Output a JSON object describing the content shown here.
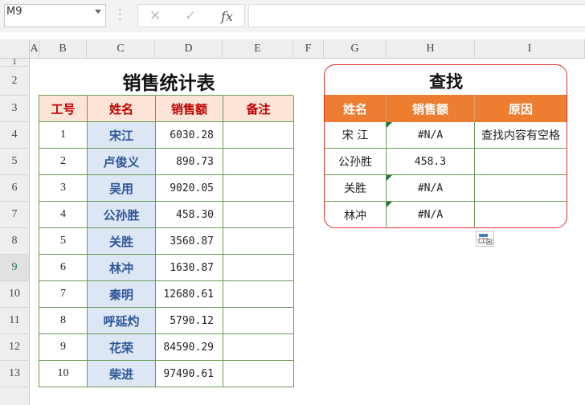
{
  "formula_bar": {
    "name_box": "M9",
    "cancel_icon": "✕",
    "enter_icon": "✓",
    "fx_label": "fx",
    "formula": ""
  },
  "columns": [
    "A",
    "B",
    "C",
    "D",
    "E",
    "F",
    "G",
    "H",
    "I"
  ],
  "rows": [
    "1",
    "2",
    "3",
    "4",
    "5",
    "6",
    "7",
    "8",
    "9",
    "10",
    "11",
    "12",
    "13"
  ],
  "active_row": "9",
  "sales_table": {
    "title": "销售统计表",
    "headers": [
      "工号",
      "姓名",
      "销售额",
      "备注"
    ],
    "rows": [
      {
        "id": "1",
        "name": "宋江",
        "amount": "6030.28",
        "note": ""
      },
      {
        "id": "2",
        "name": "卢俊义",
        "amount": "890.73",
        "note": ""
      },
      {
        "id": "3",
        "name": "吴用",
        "amount": "9020.05",
        "note": ""
      },
      {
        "id": "4",
        "name": "公孙胜",
        "amount": "458.30",
        "note": ""
      },
      {
        "id": "5",
        "name": "关胜",
        "amount": "3560.87",
        "note": ""
      },
      {
        "id": "6",
        "name": "林冲",
        "amount": "1630.87",
        "note": ""
      },
      {
        "id": "7",
        "name": "秦明",
        "amount": "12680.61",
        "note": ""
      },
      {
        "id": "8",
        "name": "呼延灼",
        "amount": "5790.12",
        "note": ""
      },
      {
        "id": "9",
        "name": "花荣",
        "amount": "84590.29",
        "note": ""
      },
      {
        "id": "10",
        "name": "柴进",
        "amount": "97490.61",
        "note": ""
      }
    ]
  },
  "lookup_table": {
    "title": "查找",
    "headers": [
      "姓名",
      "销售额",
      "原因"
    ],
    "rows": [
      {
        "name": "宋 江",
        "amount": "#N/A",
        "reason": "查找内容有空格",
        "flag": true
      },
      {
        "name": "公孙胜",
        "amount": "458.3",
        "reason": "",
        "flag": false
      },
      {
        "name": "关胜",
        "amount": "#N/A",
        "reason": "",
        "flag": true
      },
      {
        "name": "林冲",
        "amount": "#N/A",
        "reason": "",
        "flag": true
      }
    ]
  },
  "colors": {
    "header_fill_main": "#fce4d6",
    "header_text_main": "#c00000",
    "name_fill": "#dde6f4",
    "name_text": "#2f5597",
    "lookup_header_fill": "#ed7d31",
    "border_green": "#6b9c56",
    "box_red": "#e03030"
  }
}
